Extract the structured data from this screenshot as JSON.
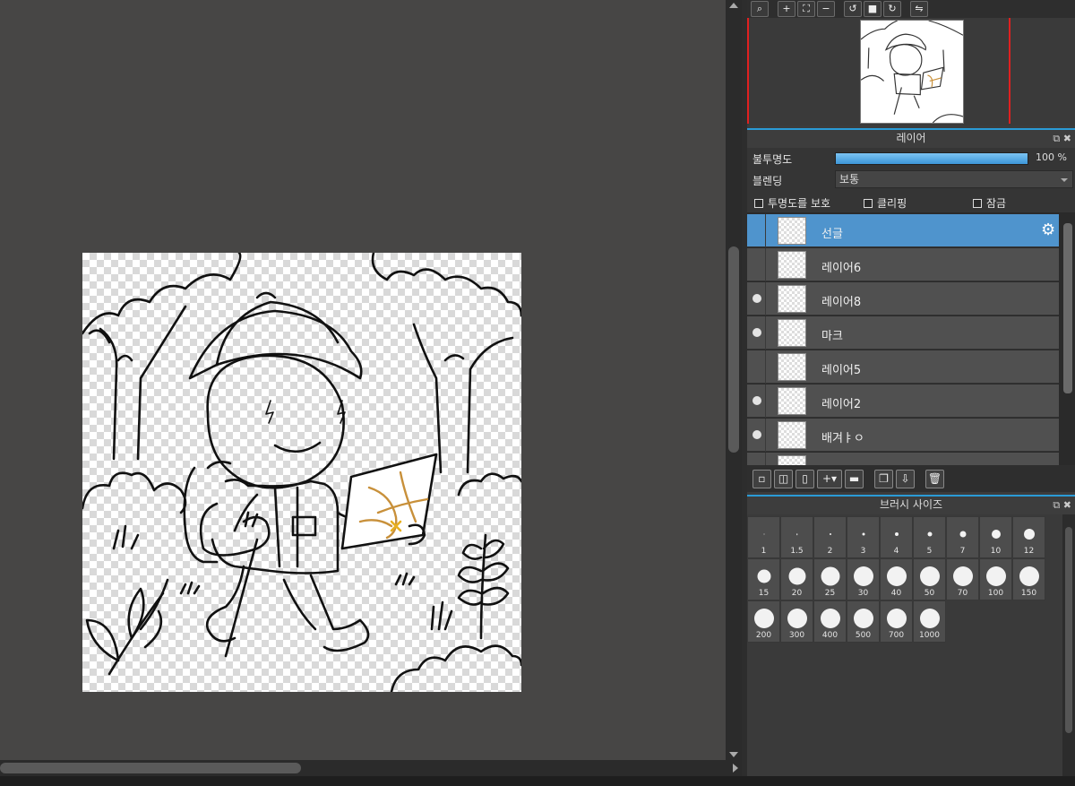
{
  "navigator": {
    "toolbar_icons": [
      "zoom-reset-icon",
      "zoom-in-icon",
      "fit-view-icon",
      "zoom-out-icon",
      "rotate-left-icon",
      "rotate-reset-icon",
      "rotate-right-icon",
      "flip-horizontal-icon"
    ]
  },
  "layer_panel": {
    "title": "레이어",
    "opacity_label": "불투명도",
    "opacity_value": "100 %",
    "opacity_fraction": 1.0,
    "blending_label": "블렌딩",
    "blending_value": "보통",
    "protect_alpha_label": "투명도를 보호",
    "clipping_label": "클리핑",
    "lock_label": "잠금",
    "layers": [
      {
        "name": "선글",
        "visible": false,
        "selected": true
      },
      {
        "name": "레이어6",
        "visible": false,
        "selected": false
      },
      {
        "name": "레이어8",
        "visible": true,
        "selected": false
      },
      {
        "name": "마크",
        "visible": true,
        "selected": false
      },
      {
        "name": "레이어5",
        "visible": false,
        "selected": false
      },
      {
        "name": "레이어2",
        "visible": true,
        "selected": false
      },
      {
        "name": "배겨ㅑㅇ",
        "visible": true,
        "selected": false
      }
    ]
  },
  "brush_panel": {
    "title": "브러시 사이즈",
    "sizes": [
      "1",
      "1.5",
      "2",
      "3",
      "4",
      "5",
      "7",
      "10",
      "12",
      "15",
      "20",
      "25",
      "30",
      "40",
      "50",
      "70",
      "100",
      "150",
      "200",
      "300",
      "400",
      "500",
      "700",
      "1000"
    ]
  },
  "colors": {
    "accent": "#2a9bd6",
    "selected_layer": "#4f94cd",
    "map_lines": "#c8903a",
    "map_x": "#e8b020"
  }
}
